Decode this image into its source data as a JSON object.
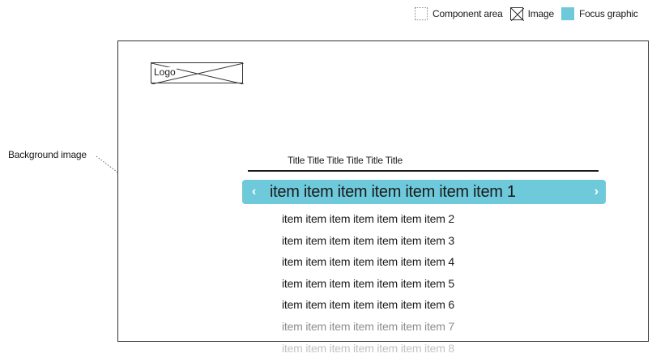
{
  "legend": {
    "component_area": "Component area",
    "image": "Image",
    "focus_graphic": "Focus graphic"
  },
  "colors": {
    "focus": "#6ec9db",
    "line": "#333333"
  },
  "logo_label": "Logo",
  "background_label": "Background image",
  "menu": {
    "title": "Title Title Title Title Title Title",
    "focused_item": "item item item item item item item 1",
    "items": [
      "item item item item item item item 2",
      "item item item item item item item 3",
      "item item item item item item item 4",
      "item item item item item item item 5",
      "item item item item item item item 6",
      "item item item item item item item 7",
      "item item item item item item item 8"
    ]
  }
}
